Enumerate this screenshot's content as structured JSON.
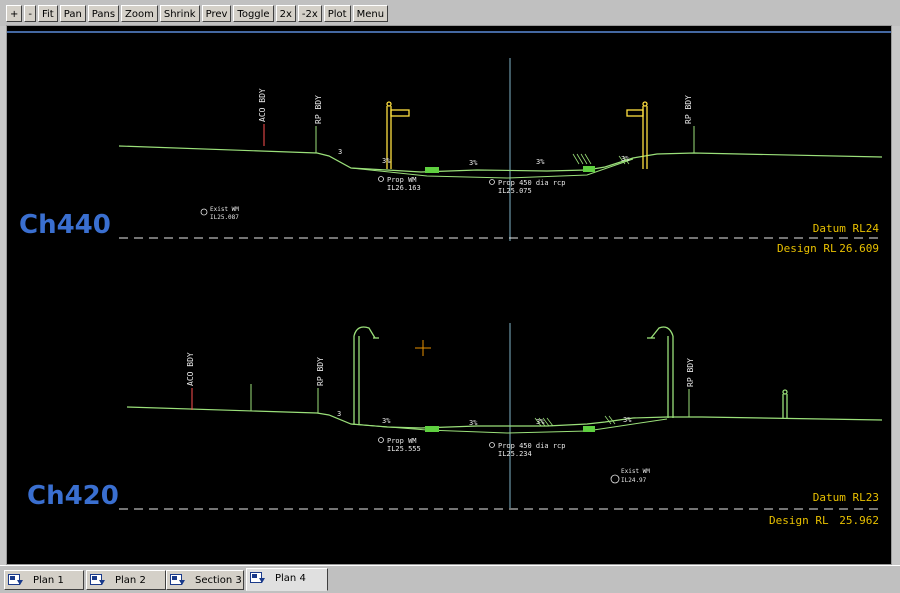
{
  "toolbar": {
    "buttons": [
      "+",
      "-",
      "Fit",
      "Pan",
      "Pans",
      "Zoom",
      "Shrink",
      "Prev",
      "Toggle",
      "2x",
      "-2x",
      "Plot",
      "Menu"
    ]
  },
  "drawing": {
    "sections": [
      {
        "chainage": "Ch440",
        "datum": "Datum RL24",
        "design_rl_label": "Design RL",
        "design_rl_value": "26.609",
        "boundary_left": "ACO BDY",
        "boundary_mid": "RP BDY",
        "boundary_right": "RP BDY",
        "slopes": [
          "3%",
          "3%",
          "3%",
          "3%"
        ],
        "side_slope": "3",
        "services": [
          {
            "name": "Prop WM",
            "level": "IL26.163"
          },
          {
            "name": "Prop 450 dia rcp",
            "level": "IL25.075"
          },
          {
            "name": "Exist WM",
            "level": "IL25.087"
          }
        ]
      },
      {
        "chainage": "Ch420",
        "datum": "Datum RL23",
        "design_rl_label": "Design RL",
        "design_rl_value": "25.962",
        "boundary_left": "ACO BDY",
        "boundary_mid": "RP BDY",
        "boundary_right": "RP BDY",
        "slopes": [
          "3%",
          "3%",
          "3%",
          "3%"
        ],
        "side_slope": "3",
        "services": [
          {
            "name": "Prop WM",
            "level": "IL25.555"
          },
          {
            "name": "Prop 450 dia rcp",
            "level": "IL25.234"
          },
          {
            "name": "Exist WM",
            "level": "IL24.97"
          }
        ]
      }
    ]
  },
  "tabs": [
    {
      "label": "Plan 1"
    },
    {
      "label": "Plan 2"
    },
    {
      "label": "Section 3"
    },
    {
      "label": "Plan 4"
    }
  ],
  "colors": {
    "road_line": "#9be07a",
    "label_blue": "#3a6fd0",
    "datum_yellow": "#e8c000",
    "crosshair": "#7fb4c8",
    "cursor": "#e89000",
    "sign_yellow": "#ffe040",
    "text_white": "#e8e8e8"
  }
}
